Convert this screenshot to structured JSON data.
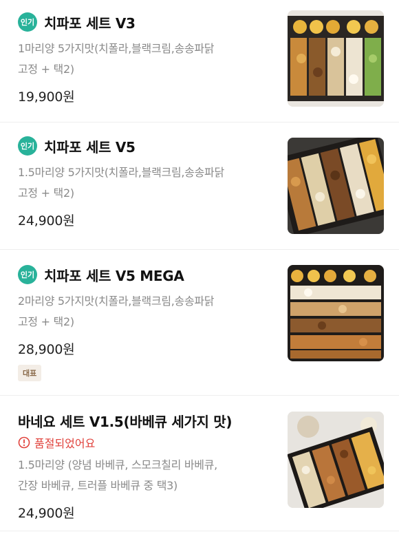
{
  "menu": {
    "items": [
      {
        "badge": "인기",
        "title": "치파포 세트 V3",
        "desc_line1": "1마리양 5가지맛(치폴라,블랙크림,송송파닭",
        "desc_line2": "고정 + 택2)",
        "price": "19,900원",
        "image": "food-box-photo"
      },
      {
        "badge": "인기",
        "title": "치파포 세트 V5",
        "desc_line1": "1.5마리양 5가지맛(치폴라,블랙크림,송송파닭",
        "desc_line2": "고정 + 택2)",
        "price": "24,900원",
        "image": "food-box-photo"
      },
      {
        "badge": "인기",
        "title": "치파포 세트 V5 MEGA",
        "desc_line1": "2마리양 5가지맛(치폴라,블랙크림,송송파닭",
        "desc_line2": "고정 + 택2)",
        "price": "28,900원",
        "tag": "대표",
        "image": "food-box-photo"
      },
      {
        "title": "바네요 세트 V1.5(바베큐 세가지 맛)",
        "soldout": "품절되었어요",
        "desc_line1": "1.5마리양 (양념 바베큐, 스모크칠리 바베큐,",
        "desc_line2": "간장 바베큐, 트러플 바베큐 중 택3)",
        "price": "24,900원",
        "image": "food-box-photo"
      }
    ]
  },
  "colors": {
    "badge": "#29b29a",
    "soldout": "#e0413b",
    "tag_bg": "#f3ede6",
    "tag_text": "#8a6a4a",
    "desc": "#8a8a8a"
  },
  "icons": {
    "soldout": "exclamation-circle-icon"
  }
}
